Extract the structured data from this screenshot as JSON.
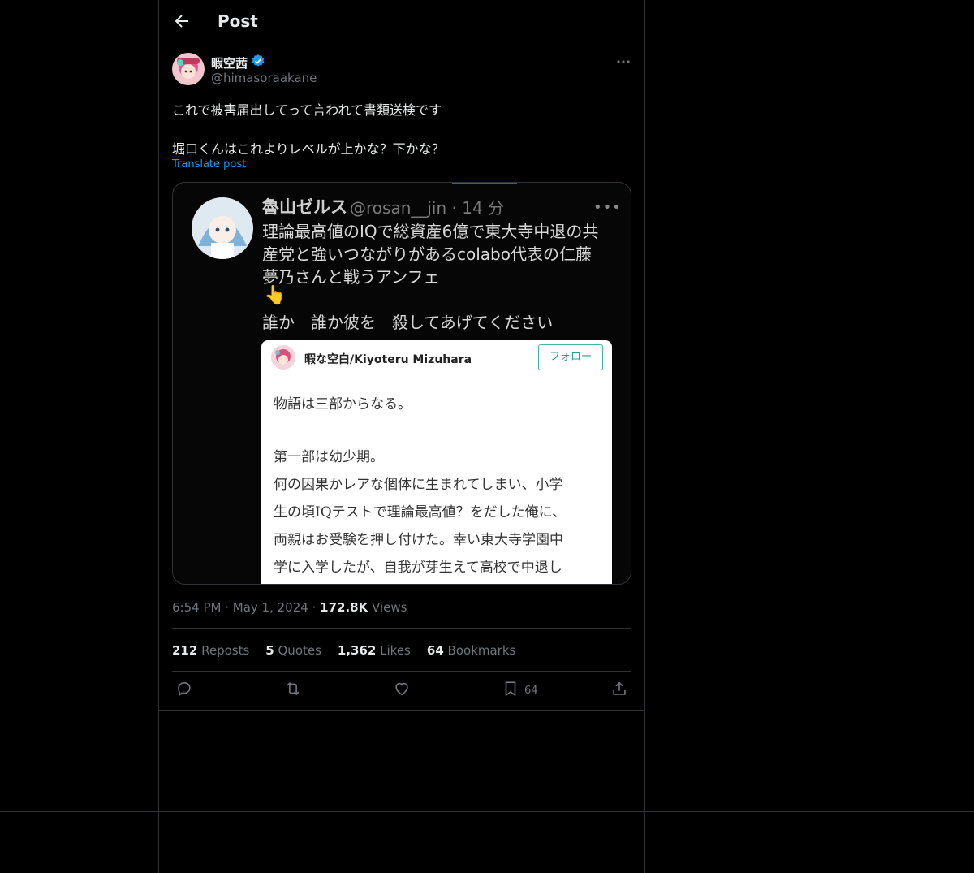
{
  "header": {
    "title": "Post"
  },
  "post": {
    "author_name": "暇空茜",
    "author_handle": "@himasoraakane",
    "text_line1": "これで被害届出してって言われて書類送検です",
    "text_line2": "堀口くんはこれよりレベルが上かな？下かな？",
    "translate_label": "Translate post",
    "time": "6:54 PM",
    "date": "May 1, 2024",
    "views_count": "172.8K",
    "views_label": "Views"
  },
  "embedded_screenshot": {
    "name": "魯山ゼルス",
    "handle_time": "@rosan__jin · 14 分",
    "more": "•••",
    "lines": [
      "理論最高値のIQで総資産6億で東大寺中退の共",
      "産党と強いつながりがあるcolabo代表の仁藤",
      "夢乃さんと戦うアンフェ",
      "誰か　誰か彼を　殺してあげてください"
    ],
    "emoji": "👆",
    "card": {
      "name": "暇な空白/Kiyoteru Mizuhara",
      "follow_label": "フォロー",
      "lines": [
        "物語は三部からなる。",
        "第一部は幼少期。",
        "何の因果かレアな個体に生まれてしまい、小学",
        "生の頃IQテストで理論最高値？をだした俺に、",
        "両親はお受験を押し付けた。幸い東大寺学園中",
        "学に入学したが、自我が芽生えて高校で中退し"
      ]
    }
  },
  "stats": [
    {
      "count": "212",
      "label": "Reposts"
    },
    {
      "count": "5",
      "label": "Quotes"
    },
    {
      "count": "1,362",
      "label": "Likes"
    },
    {
      "count": "64",
      "label": "Bookmarks"
    }
  ],
  "actions": {
    "bookmark_count": "64"
  },
  "colors": {
    "background": "#000000",
    "accent": "#1d9bf0",
    "muted": "#71767b",
    "divider": "#2f3336"
  }
}
